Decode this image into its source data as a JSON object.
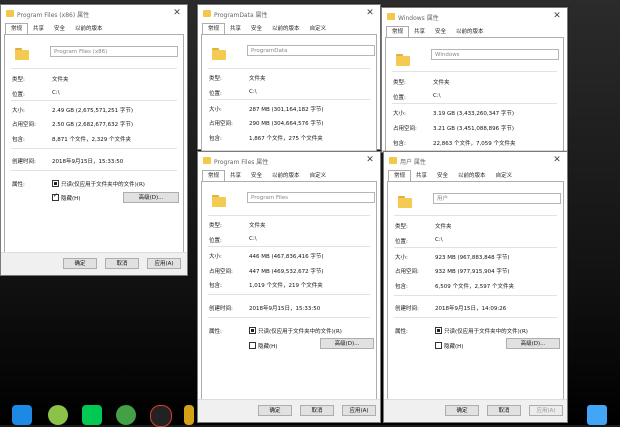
{
  "tabs_basic": [
    "常规",
    "共享",
    "安全",
    "以前的版本"
  ],
  "tabs_custom": [
    "常规",
    "共享",
    "安全",
    "以前的版本",
    "自定义"
  ],
  "labels": {
    "type": "类型:",
    "location": "位置:",
    "size": "大小:",
    "size_on_disk": "占用空间:",
    "contains": "包含:",
    "created": "创建时间:",
    "attributes": "属性:",
    "readonly": "只读(仅应用于文件夹中的文件)(R)",
    "hidden": "隐藏(H)",
    "advanced": "高级(D)...",
    "ok": "确定",
    "cancel": "取消",
    "apply": "应用(A)"
  },
  "dialogs": {
    "pf86": {
      "title": "Program Files (x86) 属性",
      "name": "Program Files (x86)",
      "type": "文件夹",
      "location": "C:\\",
      "size": "2.49 GB (2,675,571,251 字节)",
      "size_on_disk": "2.50 GB (2,682,677,632 字节)",
      "contains": "8,871 个文件，2,329 个文件夹",
      "created": "2018年9月15日，15:33:50"
    },
    "pd": {
      "title": "ProgramData 属性",
      "name": "ProgramData",
      "type": "文件夹",
      "location": "C:\\",
      "size": "287 MB (301,164,182 字节)",
      "size_on_disk": "290 MB (304,664,576 字节)",
      "contains": "1,867 个文件，275 个文件夹"
    },
    "win": {
      "title": "Windows 属性",
      "name": "Windows",
      "type": "文件夹",
      "location": "C:\\",
      "size": "3.19 GB (3,433,260,347 字节)",
      "size_on_disk": "3.21 GB (3,451,088,896 字节)",
      "contains": "22,863 个文件，7,059 个文件夹"
    },
    "pf": {
      "title": "Program Files 属性",
      "name": "Program Files",
      "type": "文件夹",
      "location": "C:\\",
      "size": "446 MB (467,836,416 字节)",
      "size_on_disk": "447 MB (469,532,672 字节)",
      "contains": "1,019 个文件，219 个文件夹",
      "created": "2018年9月15日，15:33:50"
    },
    "users": {
      "title": "用户 属性",
      "name": "用户",
      "type": "文件夹",
      "location": "C:\\",
      "size": "923 MB (967,883,848 字节)",
      "size_on_disk": "932 MB (977,915,904 字节)",
      "contains": "6,509 个文件，2,597 个文件夹",
      "created": "2018年9月15日，14:09:26"
    }
  },
  "taskbar": {
    "icons": [
      "search-app-icon",
      "qq-penguin-green-icon",
      "iqiyi-icon",
      "browser-green-icon",
      "qq-icon",
      "app-icon",
      "feather-app-icon"
    ]
  }
}
